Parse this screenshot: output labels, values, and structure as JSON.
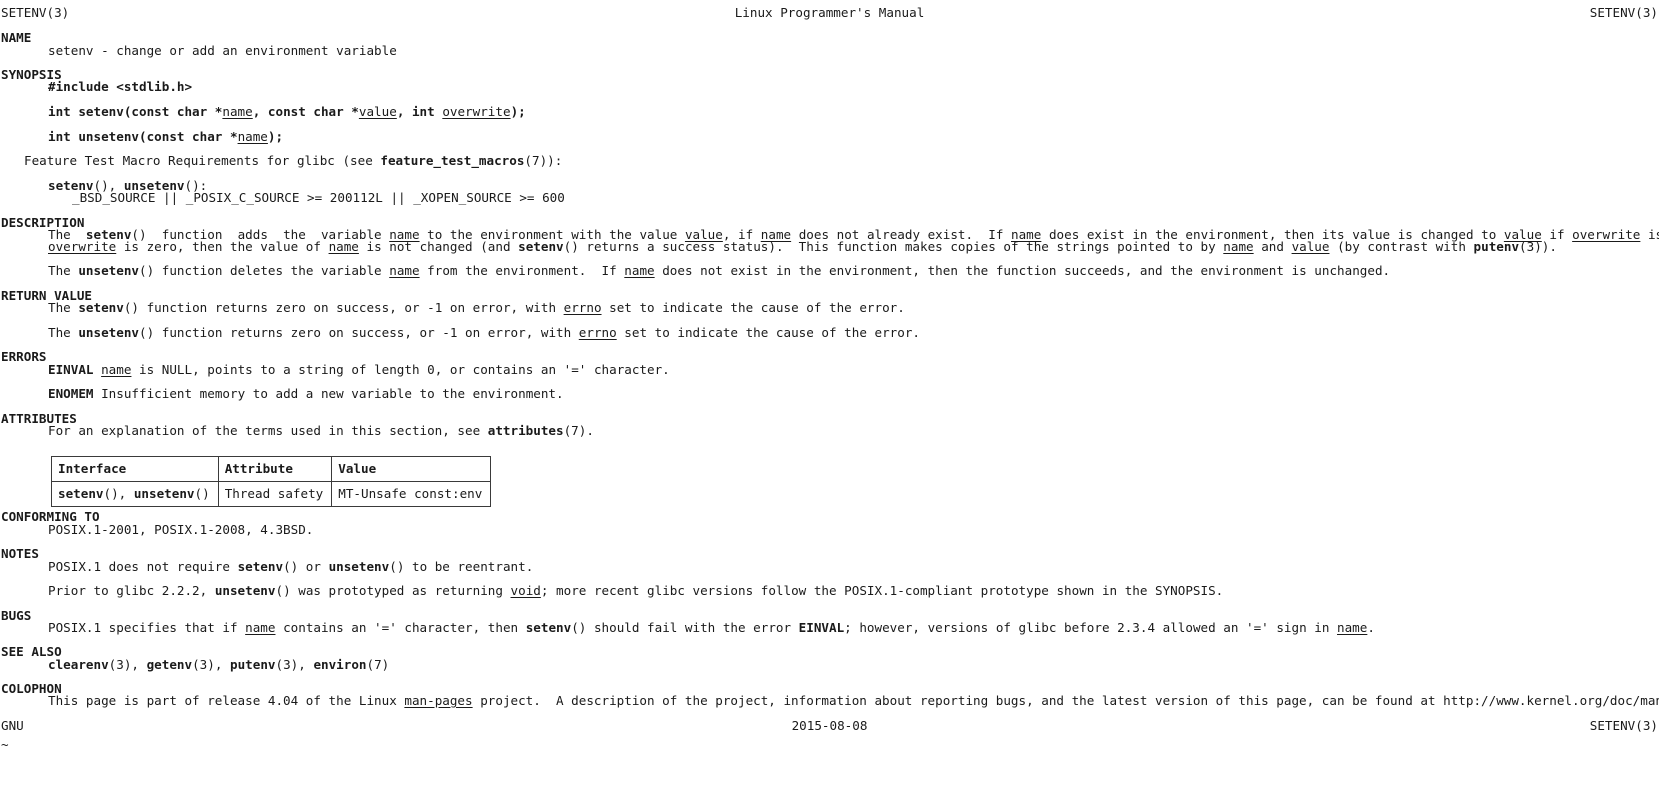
{
  "page": {
    "header": {
      "left": "SETENV(3)",
      "center": "Linux Programmer's Manual",
      "right": "SETENV(3)"
    },
    "footer": {
      "left": "GNU",
      "center": "2015-08-08",
      "right": "SETENV(3)"
    },
    "pager_filler": "~"
  },
  "sections": {
    "name": {
      "heading": "NAME",
      "body": "setenv - change or add an environment variable"
    },
    "synopsis": {
      "heading": "SYNOPSIS",
      "include": "#include <stdlib.h>",
      "proto_setenv": {
        "pre": "int setenv(const char *",
        "arg1": "name",
        "mid1": ", const char *",
        "arg2": "value",
        "mid2": ", int ",
        "arg3": "overwrite",
        "post": ");"
      },
      "proto_unsetenv": {
        "pre": "int unsetenv(const char *",
        "arg1": "name",
        "post": ");"
      },
      "ftm_intro_pre": "Feature Test Macro Requirements for glibc (see ",
      "ftm_intro_bold": "feature_test_macros",
      "ftm_intro_post": "(7)):",
      "ftm_funcs_a": "setenv",
      "ftm_funcs_b": "(), ",
      "ftm_funcs_c": "unsetenv",
      "ftm_funcs_d": "():",
      "ftm_macros": "_BSD_SOURCE || _POSIX_C_SOURCE >= 200112L || _XOPEN_SOURCE >= 600"
    },
    "description": {
      "heading": "DESCRIPTION",
      "p1_l1": {
        "t1": "The  ",
        "b1": "setenv",
        "t2": "()  function  adds  the  variable ",
        "u1": "name",
        "t3": " to the environment with the value ",
        "u2": "value",
        "t4": ", if ",
        "u3": "name",
        "t5": " does not already exist.  If ",
        "u4": "name",
        "t6": " does exist in the environment, then its value is changed to ",
        "u5": "value",
        "t7": " if ",
        "u6": "overwrite",
        "t8": " is nonzero; if"
      },
      "p1_l2": {
        "u1": "overwrite",
        "t1": " is zero, then the value of ",
        "u2": "name",
        "t2": " is not changed (and ",
        "b1": "setenv",
        "t3": "() returns a success status).  This function makes copies of the strings pointed to by ",
        "u3": "name",
        "t4": " and ",
        "u4": "value",
        "t5": " (by contrast with ",
        "b2": "putenv",
        "t6": "(3))."
      },
      "p2": {
        "t1": "The ",
        "b1": "unsetenv",
        "t2": "() function deletes the variable ",
        "u1": "name",
        "t3": " from the environment.  If ",
        "u2": "name",
        "t4": " does not exist in the environment, then the function succeeds, and the environment is unchanged."
      }
    },
    "return_value": {
      "heading": "RETURN VALUE",
      "p1": {
        "t1": "The ",
        "b1": "setenv",
        "t2": "() function returns zero on success, or -1 on error, with ",
        "u1": "errno",
        "t3": " set to indicate the cause of the error."
      },
      "p2": {
        "t1": "The ",
        "b1": "unsetenv",
        "t2": "() function returns zero on success, or -1 on error, with ",
        "u1": "errno",
        "t3": " set to indicate the cause of the error."
      }
    },
    "errors": {
      "heading": "ERRORS",
      "items": [
        {
          "code": "EINVAL",
          "u1": "name",
          "text": " is NULL, points to a string of length 0, or contains an '=' character."
        },
        {
          "code": "ENOMEM",
          "u1": "",
          "text": "Insufficient memory to add a new variable to the environment."
        }
      ]
    },
    "attributes": {
      "heading": "ATTRIBUTES",
      "intro_pre": "For an explanation of the terms used in this section, see ",
      "intro_bold": "attributes",
      "intro_post": "(7).",
      "table": {
        "columns": [
          "Interface",
          "Attribute",
          "Value"
        ],
        "rows": [
          {
            "interface_b1": "setenv",
            "interface_t1": "(), ",
            "interface_b2": "unsetenv",
            "interface_t2": "()",
            "attribute": "Thread safety",
            "value": "MT-Unsafe const:env"
          }
        ]
      }
    },
    "conforming_to": {
      "heading": "CONFORMING TO",
      "body": "POSIX.1-2001, POSIX.1-2008, 4.3BSD."
    },
    "notes": {
      "heading": "NOTES",
      "p1": {
        "t1": "POSIX.1 does not require ",
        "b1": "setenv",
        "t2": "() or ",
        "b2": "unsetenv",
        "t3": "() to be reentrant."
      },
      "p2": {
        "t1": "Prior to glibc 2.2.2, ",
        "b1": "unsetenv",
        "t2": "() was prototyped as returning ",
        "u1": "void",
        "t3": "; more recent glibc versions follow the POSIX.1-compliant prototype shown in the SYNOPSIS."
      }
    },
    "bugs": {
      "heading": "BUGS",
      "p1": {
        "t1": "POSIX.1 specifies that if ",
        "u1": "name",
        "t2": " contains an '=' character, then ",
        "b1": "setenv",
        "t3": "() should fail with the error ",
        "b2": "EINVAL",
        "t4": "; however, versions of glibc before 2.3.4 allowed an '=' sign in ",
        "u2": "name",
        "t5": "."
      }
    },
    "see_also": {
      "heading": "SEE ALSO",
      "items": [
        {
          "name": "clearenv",
          "sec": "(3), "
        },
        {
          "name": "getenv",
          "sec": "(3), "
        },
        {
          "name": "putenv",
          "sec": "(3), "
        },
        {
          "name": "environ",
          "sec": "(7)"
        }
      ]
    },
    "colophon": {
      "heading": "COLOPHON",
      "p1": {
        "t1": "This page is part of release 4.04 of the Linux ",
        "u1": "man-pages",
        "t2": " project.  A description of the project, information about reporting bugs, and the latest version of this page, can be found at http://www.kernel.org/doc/man-pages/."
      }
    }
  }
}
